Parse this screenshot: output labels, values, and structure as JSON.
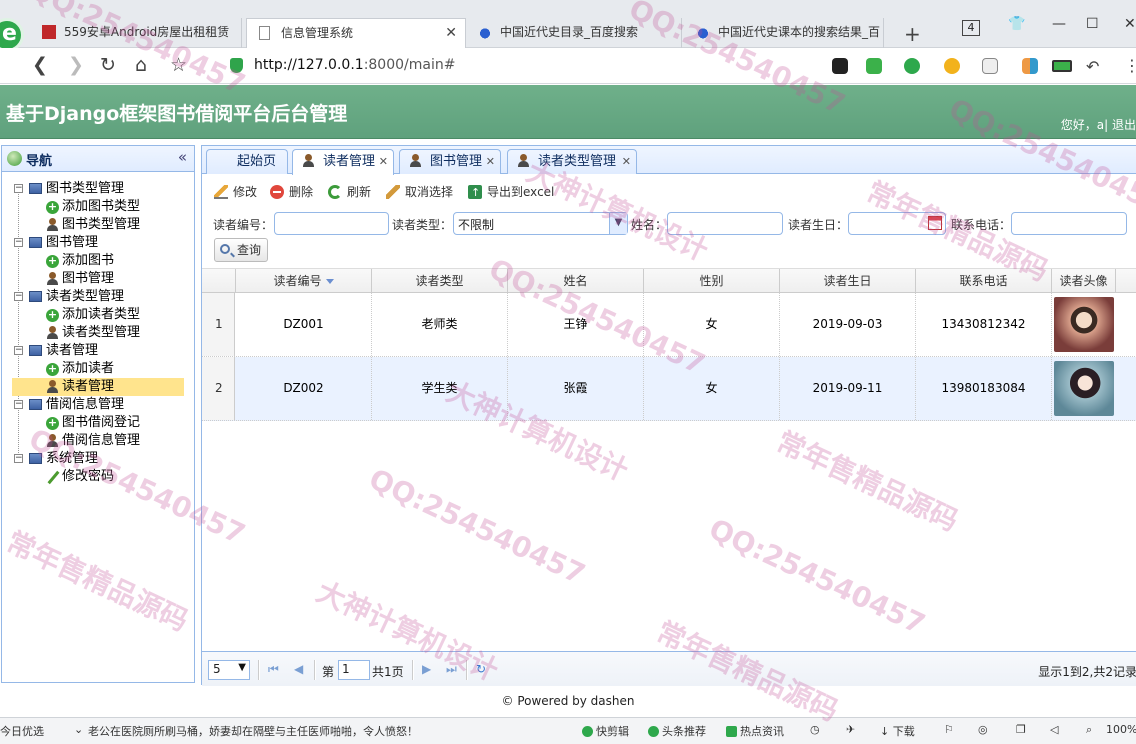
{
  "browser": {
    "tabs": [
      {
        "title": "559安卓Android房屋出租租赁"
      },
      {
        "title": "信息管理系统"
      },
      {
        "title": "中国近代史目录_百度搜索"
      },
      {
        "title": "中国近代史课本的搜索结果_百"
      }
    ],
    "tab_count": "4",
    "url_host": "http://127.0.0.1",
    "url_rest": ":8000/main#"
  },
  "app": {
    "title": "基于Django框架图书借阅平台后台管理",
    "user_greeting": "您好，a| 退出"
  },
  "sidebar": {
    "title": "导航",
    "tree": [
      {
        "label": "图书类型管理",
        "level": 0
      },
      {
        "label": "添加图书类型",
        "level": 1,
        "icon": "add"
      },
      {
        "label": "图书类型管理",
        "level": 1,
        "icon": "user"
      },
      {
        "label": "图书管理",
        "level": 0
      },
      {
        "label": "添加图书",
        "level": 1,
        "icon": "add"
      },
      {
        "label": "图书管理",
        "level": 1,
        "icon": "user"
      },
      {
        "label": "读者类型管理",
        "level": 0
      },
      {
        "label": "添加读者类型",
        "level": 1,
        "icon": "add"
      },
      {
        "label": "读者类型管理",
        "level": 1,
        "icon": "user"
      },
      {
        "label": "读者管理",
        "level": 0
      },
      {
        "label": "添加读者",
        "level": 1,
        "icon": "add"
      },
      {
        "label": "读者管理",
        "level": 1,
        "icon": "user",
        "selected": true
      },
      {
        "label": "借阅信息管理",
        "level": 0
      },
      {
        "label": "图书借阅登记",
        "level": 1,
        "icon": "add"
      },
      {
        "label": "借阅信息管理",
        "level": 1,
        "icon": "user"
      },
      {
        "label": "系统管理",
        "level": 0
      },
      {
        "label": "修改密码",
        "level": 1,
        "icon": "pen"
      }
    ]
  },
  "main": {
    "tabs": [
      {
        "label": "起始页"
      },
      {
        "label": "读者管理"
      },
      {
        "label": "图书管理"
      },
      {
        "label": "读者类型管理"
      }
    ],
    "toolbar": {
      "edit": "修改",
      "delete": "删除",
      "refresh": "刷新",
      "cancel_select": "取消选择",
      "export": "导出到excel"
    },
    "search": {
      "reader_no_label": "读者编号：",
      "reader_no_value": "",
      "reader_type_label": "读者类型：",
      "reader_type_value": "不限制",
      "name_label": "姓名：",
      "name_value": "",
      "birthday_label": "读者生日：",
      "birthday_value": "",
      "phone_label": "联系电话：",
      "phone_value": "",
      "query_button": "查询"
    },
    "grid": {
      "columns": [
        "读者编号",
        "读者类型",
        "姓名",
        "性别",
        "读者生日",
        "联系电话",
        "读者头像"
      ],
      "rows": [
        {
          "num": "1",
          "reader_no": "DZ001",
          "reader_type": "老师类",
          "name": "王铮",
          "gender": "女",
          "birthday": "2019-09-03",
          "phone": "13430812342"
        },
        {
          "num": "2",
          "reader_no": "DZ002",
          "reader_type": "学生类",
          "name": "张霞",
          "gender": "女",
          "birthday": "2019-09-11",
          "phone": "13980183084"
        }
      ]
    },
    "pager": {
      "page_size": "5",
      "page_prefix": "第",
      "page_value": "1",
      "page_total": "共1页",
      "info": "显示1到2,共2记录"
    }
  },
  "footer": "© Powered by dashen",
  "statusbar": {
    "left1": "今日优选",
    "news": "老公在医院厕所刷马桶，娇妻却在隔壁与主任医师啪啪，令人愤怒！",
    "kuaijian": "快剪辑",
    "toutiao": "头条推荐",
    "hot": "热点资讯",
    "download": "下载",
    "zoom": "100%"
  },
  "watermark": [
    "QQ:254540457",
    "大神计算机设计",
    "常年售精品源码"
  ]
}
